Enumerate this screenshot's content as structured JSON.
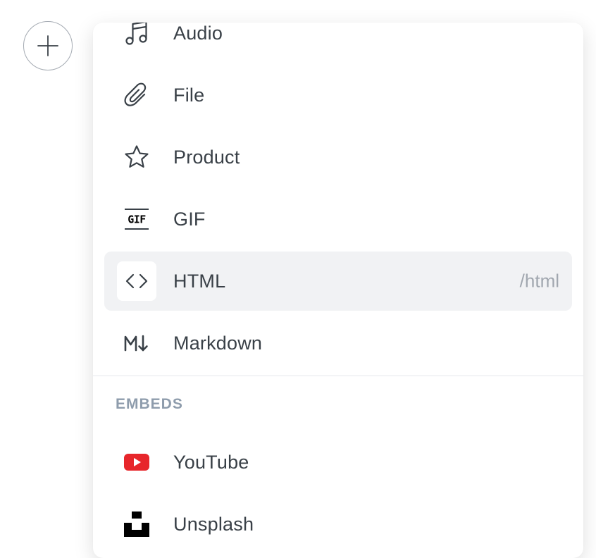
{
  "menu": {
    "items": [
      {
        "label": "Audio"
      },
      {
        "label": "File"
      },
      {
        "label": "Product"
      },
      {
        "label": "GIF"
      },
      {
        "label": "HTML",
        "shortcut": "/html",
        "selected": true
      },
      {
        "label": "Markdown"
      }
    ],
    "embeds": {
      "title": "EMBEDS",
      "items": [
        {
          "label": "YouTube"
        },
        {
          "label": "Unsplash"
        }
      ]
    }
  },
  "icons": {
    "add": "plus-icon",
    "audio": "music-note-icon",
    "file": "paperclip-icon",
    "product": "star-icon",
    "gif": "gif-icon",
    "gif_text": "GIF",
    "html": "code-brackets-icon",
    "markdown": "markdown-icon",
    "youtube": "youtube-icon",
    "unsplash": "unsplash-icon"
  },
  "colors": {
    "text": "#394047",
    "muted": "#a1a7af",
    "section": "#8e9cac",
    "selected_bg": "#f1f2f4",
    "youtube_red": "#e7262b"
  }
}
